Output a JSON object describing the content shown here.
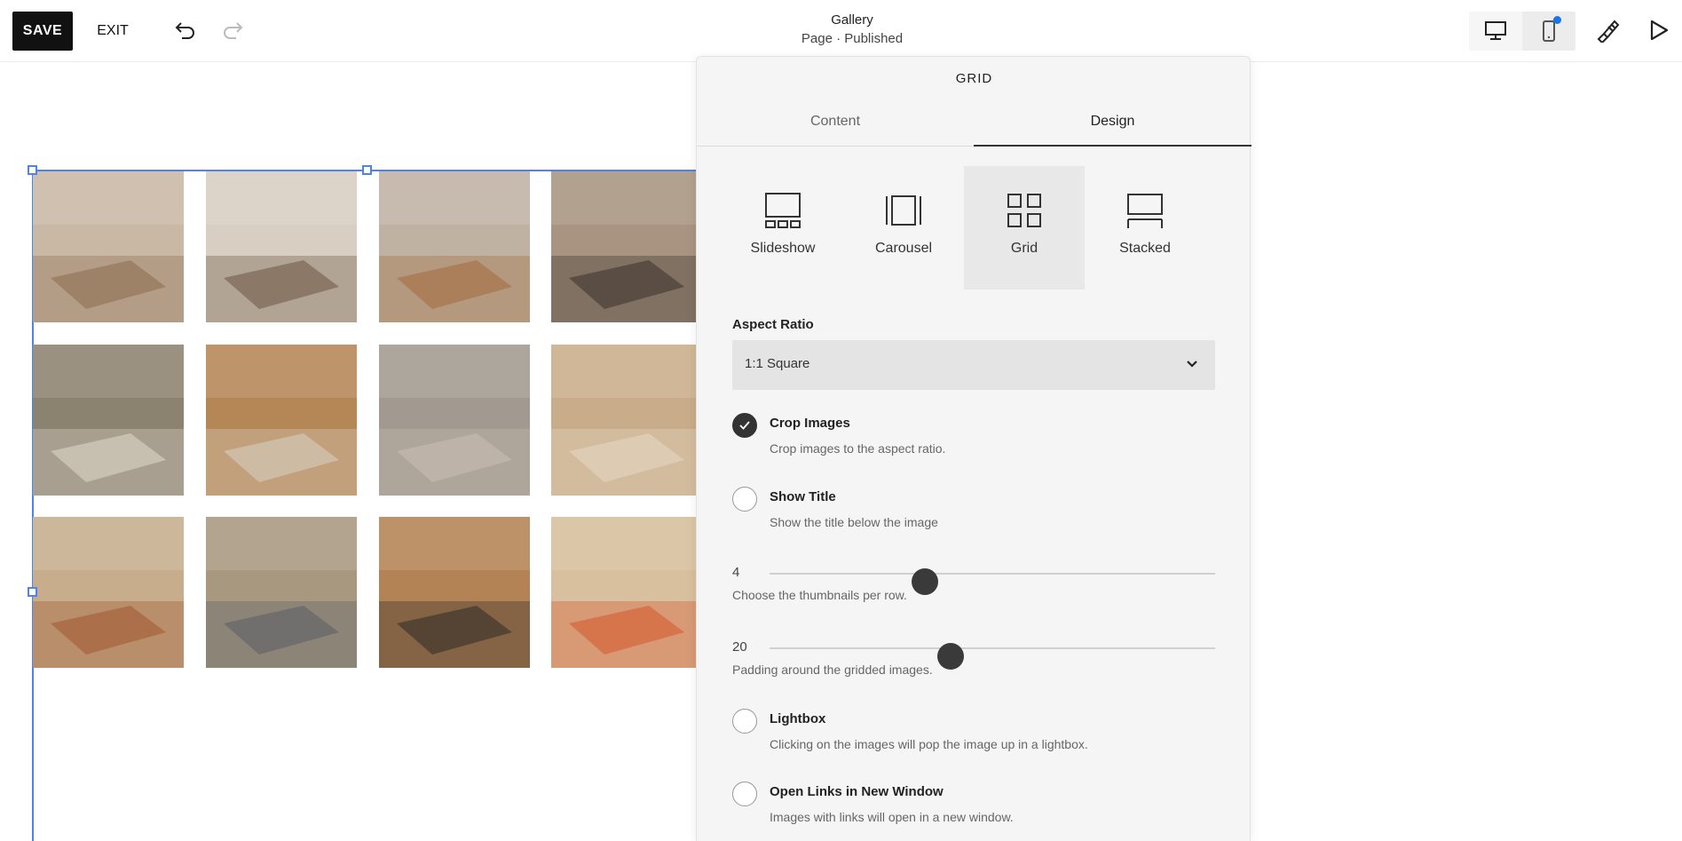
{
  "toolbar": {
    "save_label": "SAVE",
    "exit_label": "EXIT",
    "page_title": "Gallery",
    "page_status": "Page · Published"
  },
  "panel": {
    "title": "GRID",
    "tabs": [
      {
        "label": "Content",
        "active": false
      },
      {
        "label": "Design",
        "active": true
      }
    ],
    "layouts": [
      {
        "label": "Slideshow",
        "icon": "slideshow-icon",
        "active": false
      },
      {
        "label": "Carousel",
        "icon": "carousel-icon",
        "active": false
      },
      {
        "label": "Grid",
        "icon": "grid-icon",
        "active": true
      },
      {
        "label": "Stacked",
        "icon": "stacked-icon",
        "active": false
      }
    ],
    "aspect_ratio": {
      "label": "Aspect Ratio",
      "value": "1:1 Square"
    },
    "crop_images": {
      "title": "Crop Images",
      "desc": "Crop images to the aspect ratio.",
      "checked": true
    },
    "show_title": {
      "title": "Show Title",
      "desc": "Show the title below the image",
      "checked": false
    },
    "thumbnails": {
      "value": "4",
      "fraction": 0.34,
      "desc": "Choose the thumbnails per row."
    },
    "padding": {
      "value": "20",
      "fraction": 0.4,
      "desc": "Padding around the gridded images."
    },
    "lightbox": {
      "title": "Lightbox",
      "desc": "Clicking on the images will pop the image up in a lightbox.",
      "checked": false
    },
    "new_window": {
      "title": "Open Links in New Window",
      "desc": "Images with links will open in a new window.",
      "checked": false
    }
  },
  "gallery": {
    "images": [
      {
        "name": "desk-lamp-laptop-photo",
        "bg": "#c9b8a4",
        "accent": "#8b6b4f"
      },
      {
        "name": "typing-laptop-photo",
        "bg": "#d8cfc2",
        "accent": "#6b5442"
      },
      {
        "name": "mushroom-lamp-photo",
        "bg": "#bfb2a3",
        "accent": "#a26a3c"
      },
      {
        "name": "laptop-work-photo",
        "bg": "#a89480",
        "accent": "#3a302a"
      },
      {
        "name": "hands-paper-photo",
        "bg": "#8c8270",
        "accent": "#e0d8ca"
      },
      {
        "name": "notebook-wood-photo",
        "bg": "#b58656",
        "accent": "#d9d1c4"
      },
      {
        "name": "calla-lily-desk-photo",
        "bg": "#a29a90",
        "accent": "#c8beb2"
      },
      {
        "name": "glasses-desk-photo",
        "bg": "#c9ad8a",
        "accent": "#e6d8c4"
      },
      {
        "name": "paper-bowl-photo",
        "bg": "#c7ad8c",
        "accent": "#a0582f"
      },
      {
        "name": "laptop-phone-photo",
        "bg": "#a8987f",
        "accent": "#5a5f66"
      },
      {
        "name": "lamp-notebook-photo",
        "bg": "#b48355",
        "accent": "#2d2a27"
      },
      {
        "name": "orange-flower-photo",
        "bg": "#d8bf9d",
        "accent": "#d6562a"
      }
    ]
  }
}
